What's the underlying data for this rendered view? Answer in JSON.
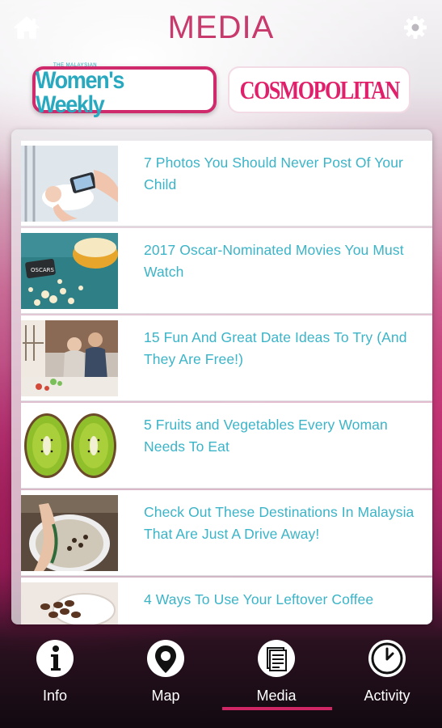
{
  "header": {
    "title": "MEDIA",
    "home_icon": "home-icon",
    "settings_icon": "gear-icon"
  },
  "brands": {
    "womens_weekly": {
      "small_text": "THE MALAYSIAN",
      "label": "Women's Weekly",
      "selected": true
    },
    "cosmopolitan": {
      "label": "COSMOPOLITAN",
      "selected": false
    }
  },
  "articles": [
    {
      "title": "7 Photos You Should Never Post Of Your Child"
    },
    {
      "title": "2017 Oscar-Nominated Movies You Must Watch"
    },
    {
      "title": "15 Fun And Great Date Ideas To Try (And They Are Free!)"
    },
    {
      "title": "5 Fruits and Vegetables Every Woman Needs To Eat"
    },
    {
      "title": "Check Out These Destinations In Malaysia That Are Just A Drive Away!"
    },
    {
      "title": "4 Ways To Use Your Leftover Coffee"
    }
  ],
  "nav": {
    "items": [
      {
        "label": "Info",
        "icon": "info-icon"
      },
      {
        "label": "Map",
        "icon": "map-pin-icon"
      },
      {
        "label": "Media",
        "icon": "newspaper-icon",
        "active": true
      },
      {
        "label": "Activity",
        "icon": "clock-icon"
      }
    ]
  },
  "colors": {
    "title": "#c83a6c",
    "article_text": "#3bb4c8",
    "accent": "#d12666",
    "womens_weekly": "#28a9c0",
    "cosmopolitan": "#e1206b"
  }
}
